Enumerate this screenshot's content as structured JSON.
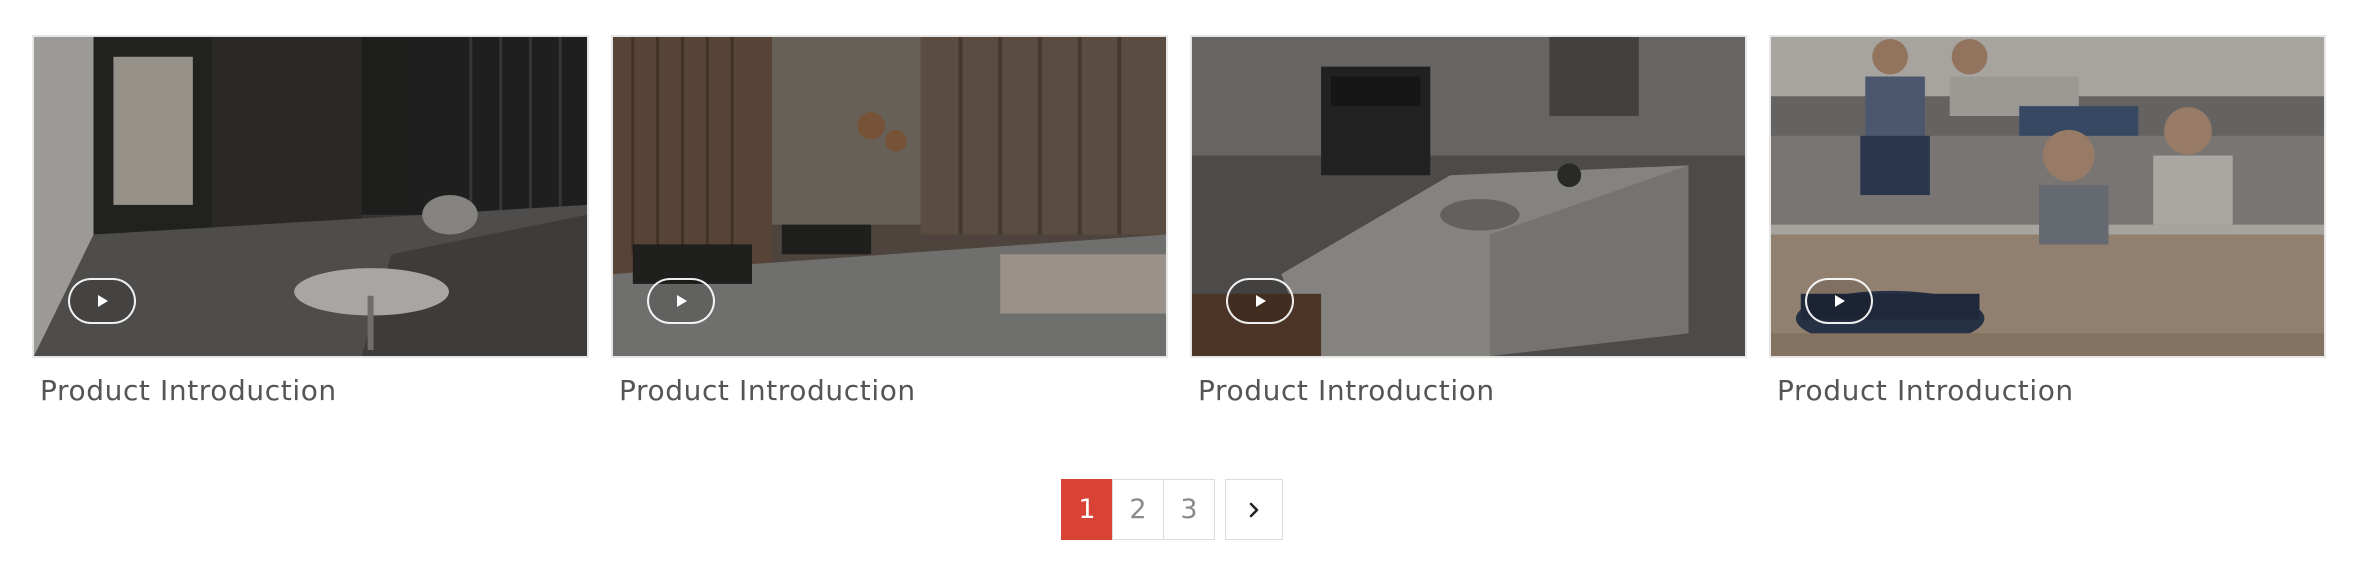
{
  "videos": [
    {
      "title": "Product Introduction",
      "icon": "play-icon"
    },
    {
      "title": "Product Introduction",
      "icon": "play-icon"
    },
    {
      "title": "Product Introduction",
      "icon": "play-icon"
    },
    {
      "title": "Product Introduction",
      "icon": "play-icon"
    }
  ],
  "pagination": {
    "pages": [
      "1",
      "2",
      "3"
    ],
    "current": "1",
    "next_icon": "chevron-right-icon",
    "active_color": "#d94336"
  }
}
